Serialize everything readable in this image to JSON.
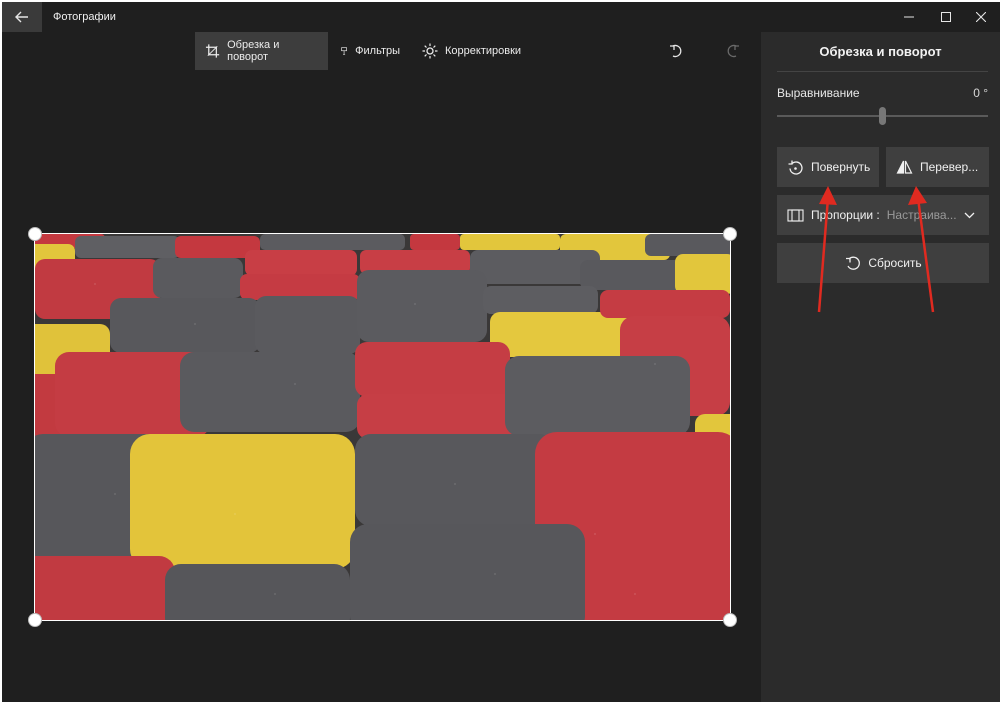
{
  "window": {
    "title": "Фотографии"
  },
  "toolbar": {
    "crop_rotate_label": "Обрезка и поворот",
    "filters_label": "Фильтры",
    "adjustments_label": "Корректировки"
  },
  "panel": {
    "title": "Обрезка и поворот",
    "straighten_label": "Выравнивание",
    "straighten_value": "0 °",
    "rotate_label": "Повернуть",
    "flip_label": "Перевер...",
    "aspect_label": "Пропорции :",
    "aspect_value": "Настраива...",
    "reset_label": "Сбросить"
  },
  "colors": {
    "accent_annotation": "#e02a20",
    "window_bg": "#1f1f1f",
    "panel_bg": "#2b2b2b",
    "button_bg": "#3f3f3f"
  },
  "icons": [
    "back-arrow-icon",
    "minimize-icon",
    "maximize-icon",
    "close-icon",
    "crop-icon",
    "filter-brush-icon",
    "brightness-icon",
    "undo-icon",
    "redo-icon",
    "rotate-icon",
    "flip-icon",
    "aspect-ratio-icon",
    "chevron-down-icon",
    "reset-icon"
  ]
}
